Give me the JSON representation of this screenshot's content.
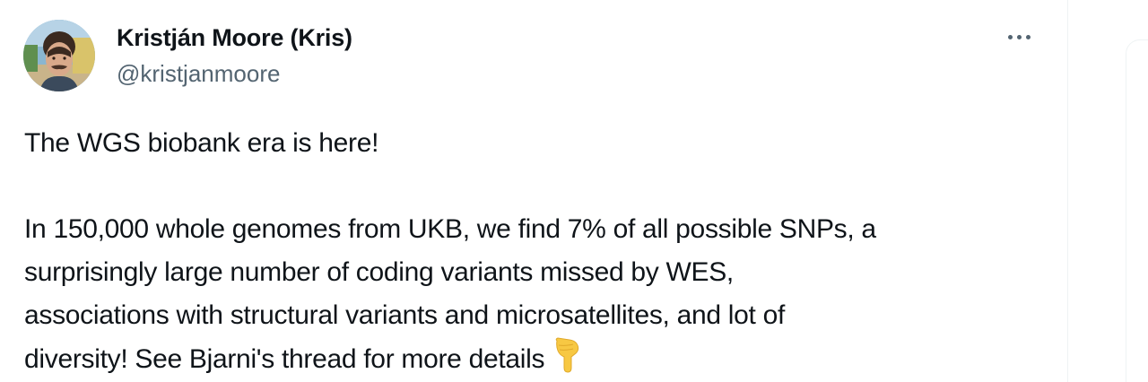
{
  "tweet": {
    "author": {
      "display_name": "Kristján Moore (Kris)",
      "handle": "@kristjanmoore"
    },
    "more_icon": "more-horizontal-icon",
    "text": {
      "line1": "The WGS biobank era is here!",
      "line2": "In 150,000 whole genomes from UKB, we find 7% of all possible SNPs, a",
      "line3": "surprisingly large number of coding variants missed by WES,",
      "line4": "associations with structural variants and microsatellites, and lot of",
      "line5": "diversity! See Bjarni's thread for more details"
    },
    "emoji": "pointing-down-hand-icon"
  },
  "colors": {
    "text_primary": "#0f1419",
    "text_secondary": "#536471",
    "divider": "#eff3f4",
    "emoji_yellow": "#f7c843"
  }
}
